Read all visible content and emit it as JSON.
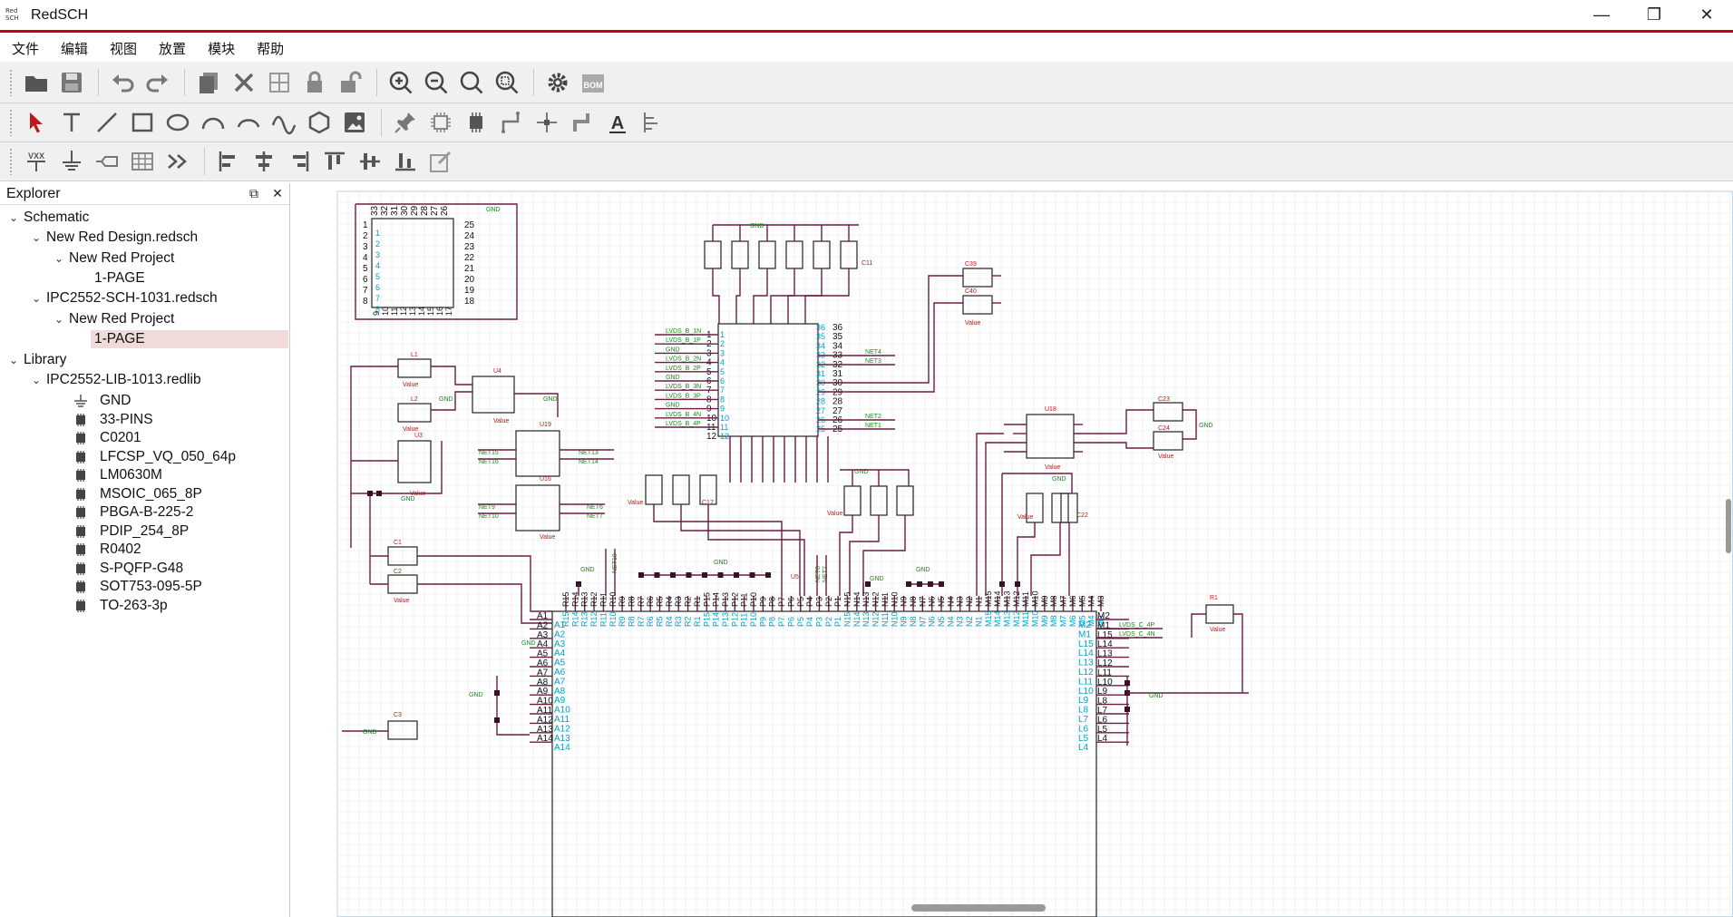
{
  "window": {
    "title": "RedSCH",
    "logo_text": "Red SCH"
  },
  "menu": [
    "文件",
    "编辑",
    "视图",
    "放置",
    "模块",
    "帮助"
  ],
  "explorer": {
    "title": "Explorer",
    "tree": [
      {
        "label": "Schematic",
        "level": 0,
        "expanded": true
      },
      {
        "label": "New Red Design.redsch",
        "level": 1,
        "expanded": true
      },
      {
        "label": "New Red Project",
        "level": 2,
        "expanded": true
      },
      {
        "label": "1-PAGE",
        "level": 3
      },
      {
        "label": "IPC2552-SCH-1031.redsch",
        "level": 1,
        "expanded": true
      },
      {
        "label": "New Red Project",
        "level": 2,
        "expanded": true
      },
      {
        "label": "1-PAGE",
        "level": 3,
        "selected": true
      },
      {
        "label": "Library",
        "level": 0,
        "expanded": true
      },
      {
        "label": "IPC2552-LIB-1013.redlib",
        "level": 1,
        "expanded": true
      }
    ],
    "library_items": [
      "GND",
      "33-PINS",
      "C0201",
      "LFCSP_VQ_050_64p",
      "LM0630M",
      "MSOIC_065_8P",
      "PBGA-B-225-2",
      "PDIP_254_8P",
      "R0402",
      "S-PQFP-G48",
      "SOT753-095-5P",
      "TO-263-3p"
    ]
  },
  "schematic": {
    "colors": {
      "wire": "#6b1d45",
      "pin_number": "#00a3c4",
      "pin_label": "#111111",
      "net": "#1a8a1a",
      "ref": "#c0181b",
      "grid": "#e6e6e6"
    },
    "labels": {
      "L1": "L1",
      "L2": "L2",
      "U3": "U3",
      "U4": "U4",
      "U19": "U19",
      "U16": "U16",
      "C1": "C1",
      "C2": "C2",
      "C3": "C3",
      "C11": "C11",
      "C17": "C17",
      "C39": "C39",
      "C40": "C40",
      "C23": "C23",
      "C24": "C24",
      "U18": "U18",
      "C22": "C22",
      "R1": "R1",
      "U5": "U5",
      "GND": "GND",
      "VALUE": "Value",
      "NET1": "NET1",
      "NET2": "NET2",
      "NET3": "NET3",
      "NET4": "NET4",
      "NET5": "NET5",
      "NET6": "NET6",
      "NET7": "NET7",
      "NET8": "NET8",
      "NET9": "NET9",
      "NET10": "NET10",
      "NET13": "NET13",
      "NET14": "NET14",
      "NET15": "NET15",
      "NET16": "NET16",
      "LVDS_C_4P": "LVDS_C_4P",
      "LVDS_C_4N": "LVDS_C_4N",
      "LVDS_B": [
        "LVDS_B_1N",
        "LVDS_B_1P",
        "GND",
        "LVDS_B_2N",
        "LVDS_B_2P",
        "GND",
        "LVDS_B_3N",
        "LVDS_B_3P",
        "GND",
        "LVDS_B_4N",
        "LVDS_B_4P"
      ]
    },
    "u5_top_pins": [
      "R15",
      "R14",
      "R13",
      "R12",
      "R11",
      "R10",
      "R9",
      "R8",
      "R7",
      "R6",
      "R5",
      "R4",
      "R3",
      "R2",
      "R1",
      "P15",
      "P14",
      "P13",
      "P12",
      "P11",
      "P10",
      "P9",
      "P8",
      "P7",
      "P6",
      "P5",
      "P4",
      "P3",
      "P2",
      "P1",
      "N15",
      "N14",
      "N13",
      "N12",
      "N11",
      "N10",
      "N9",
      "N8",
      "N7",
      "N6",
      "N5",
      "N4",
      "N3",
      "N2",
      "N1",
      "M15",
      "M14",
      "M13",
      "M12",
      "M11",
      "M10",
      "M9",
      "M8",
      "M7",
      "M6",
      "M5",
      "M4",
      "M3"
    ],
    "u5_left_pins": [
      "A1",
      "A2",
      "A3",
      "A4",
      "A5",
      "A6",
      "A7",
      "A8",
      "A9",
      "A10",
      "A11",
      "A12",
      "A13",
      "A14"
    ],
    "u5_right_pins": [
      "M2",
      "M1",
      "L15",
      "L14",
      "L13",
      "L12",
      "L11",
      "L10",
      "L9",
      "L8",
      "L7",
      "L6",
      "L5",
      "L4"
    ]
  }
}
